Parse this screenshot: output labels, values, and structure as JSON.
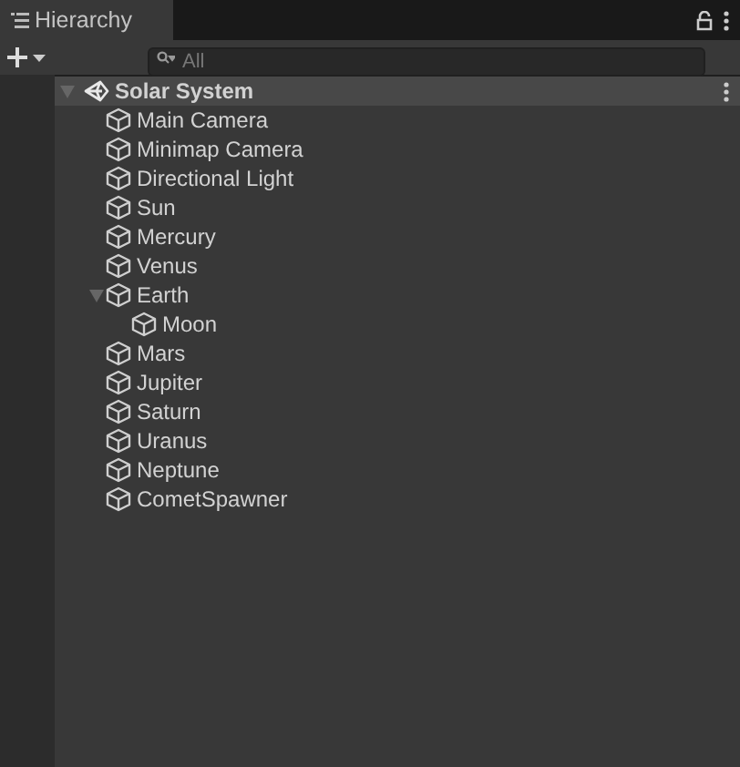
{
  "window": {
    "title": "Hierarchy"
  },
  "search": {
    "placeholder": "All"
  },
  "scene": {
    "name": "Solar System",
    "expanded": true,
    "children": [
      {
        "name": "Main Camera"
      },
      {
        "name": "Minimap Camera"
      },
      {
        "name": "Directional Light"
      },
      {
        "name": "Sun"
      },
      {
        "name": "Mercury"
      },
      {
        "name": "Venus"
      },
      {
        "name": "Earth",
        "expanded": true,
        "children": [
          {
            "name": "Moon"
          }
        ]
      },
      {
        "name": "Mars"
      },
      {
        "name": "Jupiter"
      },
      {
        "name": "Saturn"
      },
      {
        "name": "Uranus"
      },
      {
        "name": "Neptune"
      },
      {
        "name": "CometSpawner"
      }
    ]
  }
}
